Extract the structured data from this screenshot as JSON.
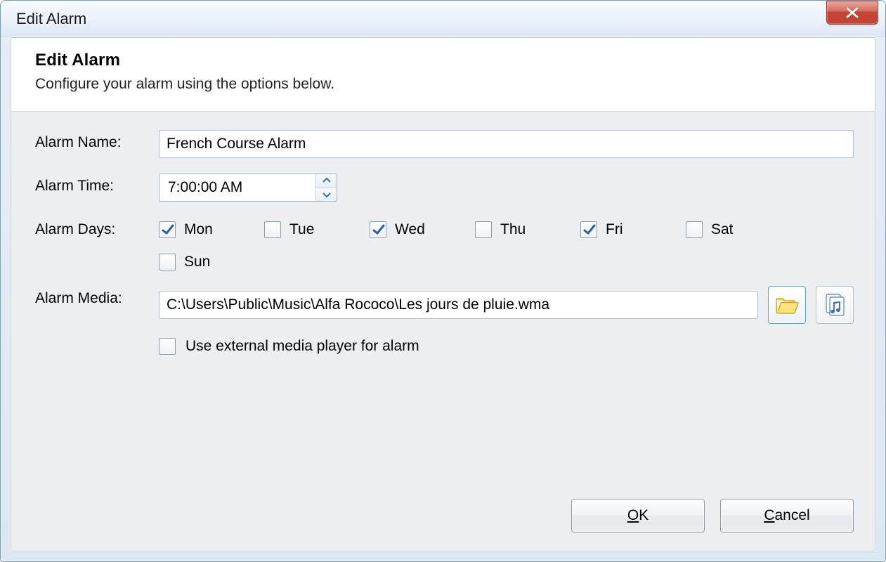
{
  "window": {
    "title": "Edit Alarm"
  },
  "header": {
    "heading": "Edit Alarm",
    "subheading": "Configure your alarm using the options below."
  },
  "labels": {
    "name": "Alarm Name:",
    "time": "Alarm Time:",
    "days": "Alarm Days:",
    "media": "Alarm Media:"
  },
  "fields": {
    "name_value": "French Course Alarm",
    "time_value": "7:00:00 AM",
    "media_value": "C:\\Users\\Public\\Music\\Alfa Rococo\\Les jours de pluie.wma",
    "use_external_label": "Use external media player for alarm",
    "use_external_checked": false
  },
  "days": [
    {
      "key": "mon",
      "label": "Mon",
      "checked": true
    },
    {
      "key": "tue",
      "label": "Tue",
      "checked": false
    },
    {
      "key": "wed",
      "label": "Wed",
      "checked": true
    },
    {
      "key": "thu",
      "label": "Thu",
      "checked": false
    },
    {
      "key": "fri",
      "label": "Fri",
      "checked": true
    },
    {
      "key": "sat",
      "label": "Sat",
      "checked": false
    },
    {
      "key": "sun",
      "label": "Sun",
      "checked": false
    }
  ],
  "buttons": {
    "ok_prefix": "O",
    "ok_rest": "K",
    "cancel_prefix": "C",
    "cancel_rest": "ancel"
  }
}
